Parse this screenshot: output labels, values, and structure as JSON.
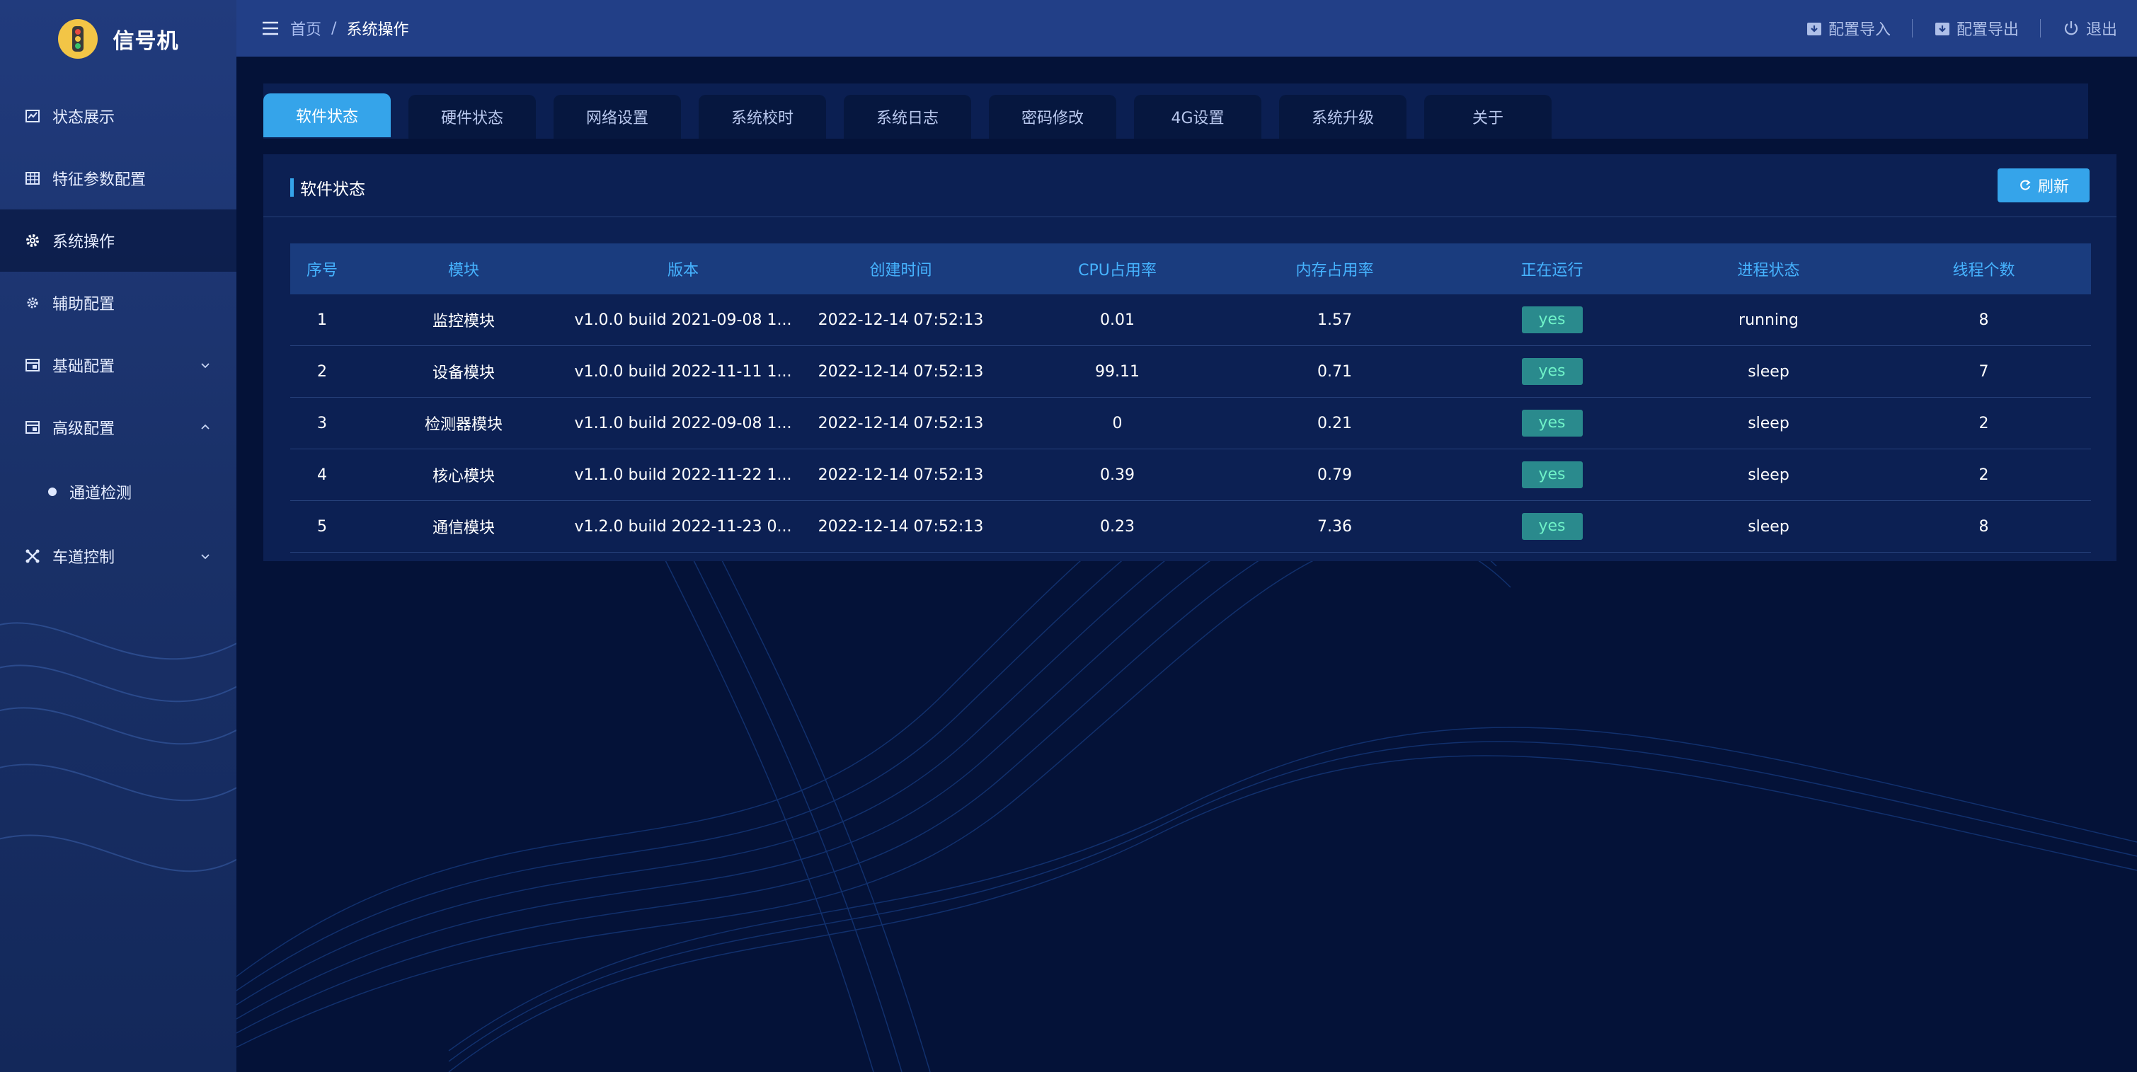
{
  "app": {
    "title": "信号机"
  },
  "sidebar": {
    "items": [
      {
        "label": "状态展示",
        "icon": "chart-icon"
      },
      {
        "label": "特征参数配置",
        "icon": "grid-icon"
      },
      {
        "label": "系统操作",
        "icon": "gear-icon",
        "active": true
      },
      {
        "label": "辅助配置",
        "icon": "cog-small-icon"
      },
      {
        "label": "基础配置",
        "icon": "window-icon",
        "expand": "chevron-down-icon"
      },
      {
        "label": "高级配置",
        "icon": "window-icon",
        "expand": "chevron-up-icon"
      },
      {
        "label": "通道检测",
        "icon": "dot-icon",
        "sub": true
      },
      {
        "label": "车道控制",
        "icon": "cross-icon",
        "expand": "chevron-down-icon"
      }
    ]
  },
  "header": {
    "breadcrumb": {
      "home": "首页",
      "separator": "/",
      "current": "系统操作"
    },
    "actions": {
      "import": "配置导入",
      "export": "配置导出",
      "logout": "退出"
    }
  },
  "tabs": [
    "软件状态",
    "硬件状态",
    "网络设置",
    "系统校时",
    "系统日志",
    "密码修改",
    "4G设置",
    "系统升级",
    "关于"
  ],
  "active_tab": "软件状态",
  "card": {
    "title": "软件状态",
    "refresh": "刷新"
  },
  "table": {
    "columns": [
      "序号",
      "模块",
      "版本",
      "创建时间",
      "CPU占用率",
      "内存占用率",
      "正在运行",
      "进程状态",
      "线程个数"
    ],
    "rows": [
      [
        "1",
        "监控模块",
        "v1.0.0 build 2021-09-08 1...",
        "2022-12-14 07:52:13",
        "0.01",
        "1.57",
        "yes",
        "running",
        "8"
      ],
      [
        "2",
        "设备模块",
        "v1.0.0 build 2022-11-11 1...",
        "2022-12-14 07:52:13",
        "99.11",
        "0.71",
        "yes",
        "sleep",
        "7"
      ],
      [
        "3",
        "检测器模块",
        "v1.1.0 build 2022-09-08 1...",
        "2022-12-14 07:52:13",
        "0",
        "0.21",
        "yes",
        "sleep",
        "2"
      ],
      [
        "4",
        "核心模块",
        "v1.1.0 build 2022-11-22 1...",
        "2022-12-14 07:52:13",
        "0.39",
        "0.79",
        "yes",
        "sleep",
        "2"
      ],
      [
        "5",
        "通信模块",
        "v1.2.0 build 2022-11-23 0...",
        "2022-12-14 07:52:13",
        "0.23",
        "7.36",
        "yes",
        "sleep",
        "8"
      ]
    ]
  },
  "colors": {
    "accent": "#35a4ea",
    "background": "#041238",
    "sidebar": "#1a3169",
    "header": "#223f87",
    "table_header_text": "#46b3ff",
    "badge_bg": "#2a8a8d",
    "badge_text": "#6ff2c8"
  }
}
